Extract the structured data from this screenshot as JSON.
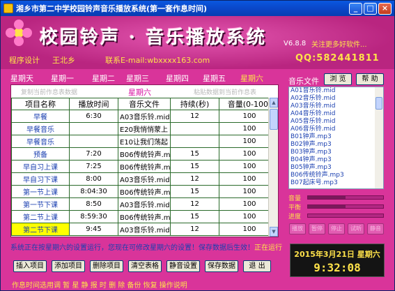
{
  "window": {
    "title": "湘乡市第二中学校园铃声音乐播放系统(第一套作息时间)",
    "minimize_glyph": "_",
    "maximize_glyph": "□",
    "close_glyph": "×"
  },
  "banner": {
    "title": "校园铃声 · 音乐播放系统",
    "version": "V6.8.8",
    "scroll_text": "关注更多好软件...",
    "design_label": "程序设计",
    "author_label": "王北乡",
    "email_label": "联系E-mail:wbxxxx163.com",
    "qq": "QQ:582441811"
  },
  "days": [
    "星期天",
    "星期一",
    "星期二",
    "星期三",
    "星期四",
    "星期五",
    "星期六"
  ],
  "active_day_index": 6,
  "schedule": {
    "hint_left": "复制当前作息表数据",
    "hint_day": "星期六",
    "hint_right": "粘贴数据到当前作息表",
    "headers": [
      "项目名称",
      "播放时间",
      "音乐文件",
      "持续(秒)",
      "音量(0-100)"
    ],
    "rows": [
      {
        "name": "早餐",
        "time": "6:30",
        "file": "A03音乐铃.mid",
        "duration": "12",
        "volume": "100"
      },
      {
        "name": "早餐音乐",
        "time": "",
        "file": "E20我悄悄蒙上",
        "duration": "",
        "volume": "100"
      },
      {
        "name": "早餐音乐",
        "time": "",
        "file": "E10让我们荡起",
        "duration": "",
        "volume": "100"
      },
      {
        "name": "预备",
        "time": "7:20",
        "file": "B06传统铃声.m",
        "duration": "15",
        "volume": "100"
      },
      {
        "name": "早自习上课",
        "time": "7:25",
        "file": "B06传统铃声.m",
        "duration": "15",
        "volume": "100"
      },
      {
        "name": "早自习下课",
        "time": "8:00",
        "file": "A03音乐铃.mid",
        "duration": "12",
        "volume": "100"
      },
      {
        "name": "第一节上课",
        "time": "8:04:30",
        "file": "B06传统铃声.m",
        "duration": "15",
        "volume": "100"
      },
      {
        "name": "第一节下课",
        "time": "8:50",
        "file": "A03音乐铃.mid",
        "duration": "12",
        "volume": "100"
      },
      {
        "name": "第二节上课",
        "time": "8:59:30",
        "file": "B06传统铃声.m",
        "duration": "15",
        "volume": "100"
      },
      {
        "name": "第二节下课",
        "time": "9:45",
        "file": "A03音乐铃.mid",
        "duration": "12",
        "volume": "100"
      }
    ],
    "selected_row_index": 9
  },
  "status_message": "系统正在按星期六的设置运行，您现在可修改星期六的设置！保存数据后生效！",
  "status_right": "正在运行",
  "buttons": [
    "插入项目",
    "添加项目",
    "删除项目",
    "清空表格",
    "静音设置",
    "保存数据",
    "退  出"
  ],
  "footer_links": "作息时间选用调  暂  星  静  报  时  删  除  备份  恢复  操作说明",
  "music_panel": {
    "label": "音乐文件",
    "browse_label": "浏  览",
    "help_label": "帮  助",
    "files": [
      "A01音乐铃.mid",
      "A02音乐铃.mid",
      "A03音乐铃.mid",
      "A04音乐铃.mid",
      "A05音乐铃.mid",
      "A06音乐铃.mid",
      "B01钟声.mp3",
      "B02钟声.mp3",
      "B03钟声.mp3",
      "B04钟声.mp3",
      "B05钟声.mp3",
      "B06传统铃声.mp3",
      "B07起床号.mp3"
    ]
  },
  "sliders": [
    {
      "label": "音量",
      "value": 0.5
    },
    {
      "label": "平衡",
      "value": 0.5
    },
    {
      "label": "进度",
      "value": 0.0
    }
  ],
  "control_buttons": [
    "播放",
    "暂停",
    "停止",
    "试听",
    "静音"
  ],
  "clock": {
    "date": "2015年3月21日  星期六",
    "time": "9:32:08"
  }
}
